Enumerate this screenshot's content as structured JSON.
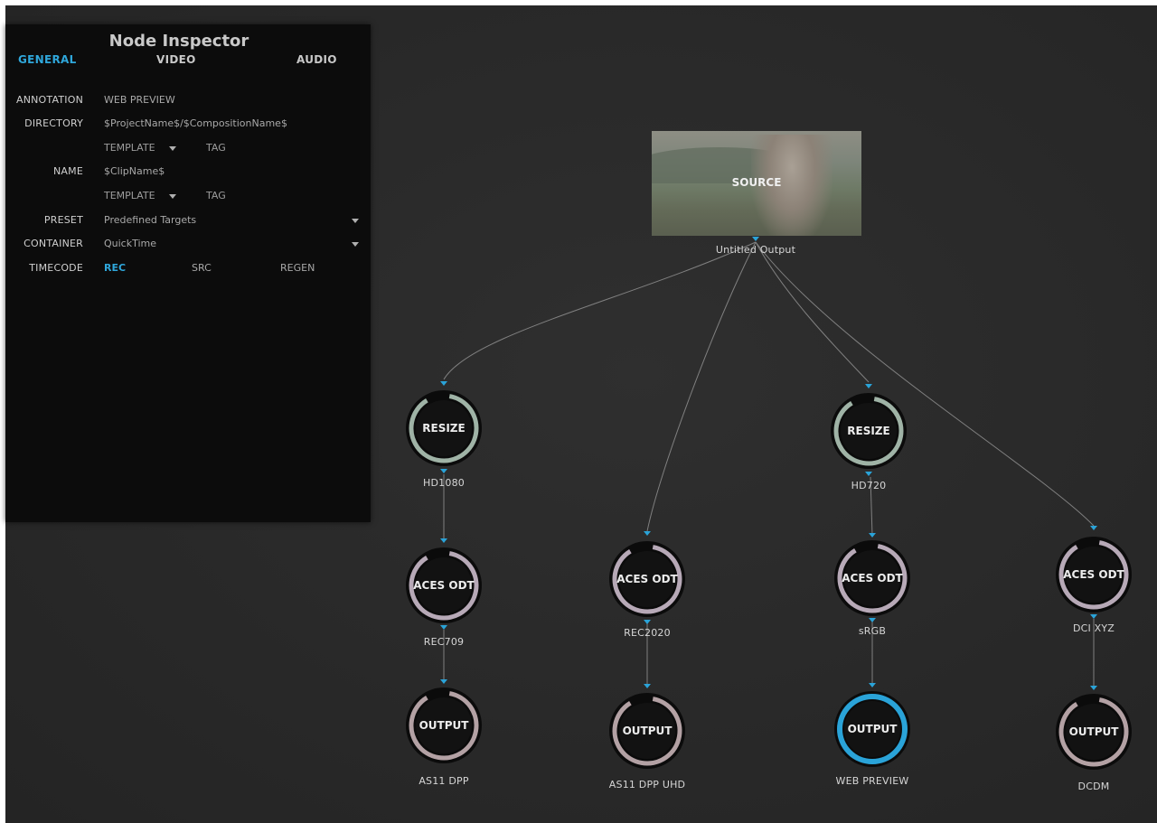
{
  "inspector": {
    "title": "Node Inspector",
    "tabs": [
      {
        "label": "GENERAL",
        "active": true
      },
      {
        "label": "VIDEO",
        "active": false
      },
      {
        "label": "AUDIO",
        "active": false
      }
    ],
    "fields": {
      "annotation": {
        "label": "ANNOTATION",
        "value": "WEB PREVIEW"
      },
      "directory": {
        "label": "DIRECTORY",
        "value": "$ProjectName$/$CompositionName$",
        "template": "TEMPLATE",
        "tag": "TAG"
      },
      "name": {
        "label": "NAME",
        "value": "$ClipName$",
        "template": "TEMPLATE",
        "tag": "TAG"
      },
      "preset": {
        "label": "PRESET",
        "value": "Predefined Targets"
      },
      "container": {
        "label": "CONTAINER",
        "value": "QuickTime"
      },
      "timecode": {
        "label": "TIMECODE",
        "options": [
          "REC",
          "SRC",
          "REGEN"
        ],
        "selected": "REC"
      }
    }
  },
  "graph": {
    "source": {
      "label": "SOURCE",
      "caption": "Untitled Output"
    },
    "nodes": {
      "resize_hd1080": {
        "label": "RESIZE",
        "caption": "HD1080"
      },
      "resize_hd720": {
        "label": "RESIZE",
        "caption": "HD720"
      },
      "odt_rec709": {
        "label": "ACES ODT",
        "caption": "REC709"
      },
      "odt_rec2020": {
        "label": "ACES ODT",
        "caption": "REC2020"
      },
      "odt_srgb": {
        "label": "ACES ODT",
        "caption": "sRGB"
      },
      "odt_dcixyz": {
        "label": "ACES ODT",
        "caption": "DCI XYZ"
      },
      "out_as11": {
        "label": "OUTPUT",
        "caption": "AS11 DPP"
      },
      "out_as11uhd": {
        "label": "OUTPUT",
        "caption": "AS11 DPP UHD"
      },
      "out_web": {
        "label": "OUTPUT",
        "caption": "WEB PREVIEW",
        "selected": true
      },
      "out_dcdm": {
        "label": "OUTPUT",
        "caption": "DCDM"
      }
    },
    "colors": {
      "accent": "#2aa3d8",
      "resize_ring": "#9fb3a6",
      "odt_ring": "#b7a9b7",
      "output_ring": "#b3a1a4",
      "edge": "#8f8f8f"
    }
  }
}
